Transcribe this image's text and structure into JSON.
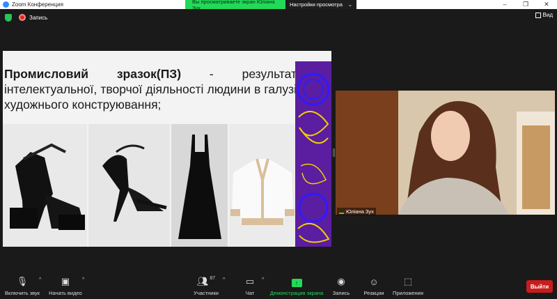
{
  "window": {
    "title": "Zoom Конференция"
  },
  "share_bar": {
    "viewing_text": "Вы просматриваете экран Юліана Зух",
    "options_label": "Настройки просмотра"
  },
  "topbar": {
    "recording_label": "Запись",
    "view_label": "Вид"
  },
  "slide": {
    "term": "Промисловий зразок(ПЗ)",
    "definition": " - результат інтелектуальної, творчої діяльності людини в галузі художнього конструювання;"
  },
  "participant": {
    "name": "Юліана Зух"
  },
  "toolbar": {
    "unmute_label": "Включить звук",
    "video_label": "Начать видео",
    "participants_label": "Участники",
    "participants_count": "87",
    "chat_label": "Чат",
    "share_label": "Демонстрация экрана",
    "record_label": "Запись",
    "reactions_label": "Реакции",
    "apps_label": "Приложения",
    "leave_label": "Выйти"
  },
  "colors": {
    "share_green": "#23d959",
    "leave_red": "#c81d1d",
    "deco_purple": "#5b1ea0"
  }
}
